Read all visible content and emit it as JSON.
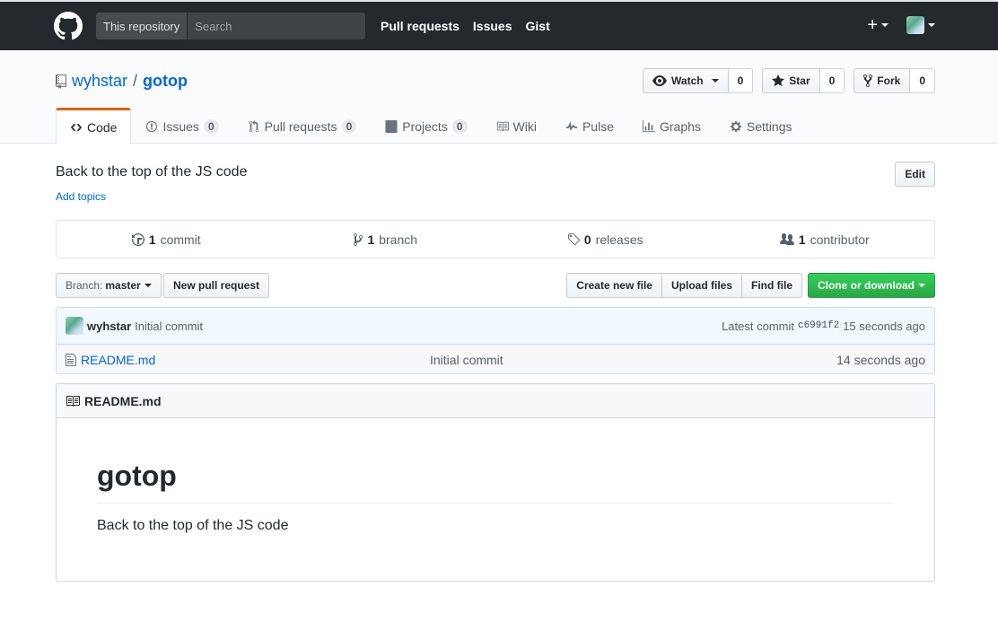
{
  "header": {
    "search_scope": "This repository",
    "search_placeholder": "Search",
    "nav": [
      "Pull requests",
      "Issues",
      "Gist"
    ],
    "plus_label": "+"
  },
  "repo": {
    "owner": "wyhstar",
    "separator": "/",
    "name": "gotop",
    "watch_label": "Watch",
    "watch_count": "0",
    "star_label": "Star",
    "star_count": "0",
    "fork_label": "Fork",
    "fork_count": "0"
  },
  "reponav": [
    {
      "label": "Code",
      "counter": null,
      "selected": true,
      "icon": "code-icon"
    },
    {
      "label": "Issues",
      "counter": "0",
      "selected": false,
      "icon": "issue-icon"
    },
    {
      "label": "Pull requests",
      "counter": "0",
      "selected": false,
      "icon": "pull-request-icon"
    },
    {
      "label": "Projects",
      "counter": "0",
      "selected": false,
      "icon": "project-icon"
    },
    {
      "label": "Wiki",
      "counter": null,
      "selected": false,
      "icon": "book-icon"
    },
    {
      "label": "Pulse",
      "counter": null,
      "selected": false,
      "icon": "pulse-icon"
    },
    {
      "label": "Graphs",
      "counter": null,
      "selected": false,
      "icon": "graph-icon"
    },
    {
      "label": "Settings",
      "counter": null,
      "selected": false,
      "icon": "gear-icon"
    }
  ],
  "content": {
    "description": "Back to the top of the JS code",
    "add_topics": "Add topics",
    "edit_label": "Edit"
  },
  "summary": {
    "commits_num": "1",
    "commits_label": "commit",
    "branches_num": "1",
    "branches_label": "branch",
    "releases_num": "0",
    "releases_label": "releases",
    "contributors_num": "1",
    "contributors_label": "contributor"
  },
  "file_nav": {
    "branch_label": "Branch:",
    "branch_value": "master",
    "new_pr": "New pull request",
    "create_file": "Create new file",
    "upload_files": "Upload files",
    "find_file": "Find file",
    "clone": "Clone or download"
  },
  "commit": {
    "author": "wyhstar",
    "message": "Initial commit",
    "latest_label": "Latest commit",
    "sha": "c6991f2",
    "age": "15 seconds ago"
  },
  "files": [
    {
      "name": "README.md",
      "message": "Initial commit",
      "age": "14 seconds ago"
    }
  ],
  "readme": {
    "title": "README.md",
    "h1": "gotop",
    "paragraph": "Back to the top of the JS code"
  },
  "colors": {
    "header_bg": "#24292e",
    "link": "#0366d6",
    "selected_tab": "#e36209",
    "clone_green": "#28a745"
  }
}
